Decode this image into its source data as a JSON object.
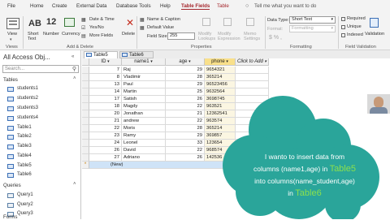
{
  "ribbon_tabs": [
    "File",
    "Home",
    "Create",
    "External Data",
    "Database Tools",
    "Help",
    "Table Fields",
    "Table"
  ],
  "tell_me": "Tell me what you want to do",
  "ribbon": {
    "view": "View",
    "views_group": "Views",
    "short_text": "Short Text",
    "number": "Number",
    "currency": "Currency",
    "date_time": "Date & Time",
    "yes_no": "Yes/No",
    "more_fields": "More Fields",
    "delete": "Delete",
    "add_delete_group": "Add & Delete",
    "name_caption": "Name & Caption",
    "default_value": "Default Value",
    "field_size_label": "Field Size",
    "field_size_value": "255",
    "modify_lookups": "Modify Lookups",
    "modify_expression": "Modify Expression",
    "memo_settings": "Memo Settings",
    "properties_group": "Properties",
    "data_type_label": "Data Type:",
    "data_type_value": "Short Text",
    "format_label": "Format:",
    "format_value": "Formatting",
    "formatting_group": "Formatting",
    "required": "Required",
    "unique": "Unique",
    "indexed": "Indexed",
    "validation": "Validation",
    "field_validation_group": "Field Validation",
    "number_glyph": "12"
  },
  "nav": {
    "title": "All Access Obj...",
    "search_placeholder": "Search...",
    "tables_header": "Tables",
    "tables": [
      "students1",
      "students2",
      "students3",
      "students4",
      "Table1",
      "Table2",
      "Table3",
      "Table4",
      "Table5",
      "Table6"
    ],
    "queries_header": "Queries",
    "queries": [
      "Query1",
      "Query2",
      "Query3"
    ],
    "forms_header": "Forms"
  },
  "doc_tabs": [
    "Table5",
    "Table6"
  ],
  "grid": {
    "columns": [
      "ID",
      "name1",
      "age",
      "phone",
      "Click to Add"
    ],
    "rows": [
      [
        "7",
        "Raj",
        "29",
        "9654321"
      ],
      [
        "8",
        "Vladimir",
        "28",
        "365214"
      ],
      [
        "13",
        "Paul",
        "29",
        "96523456"
      ],
      [
        "14",
        "Martin",
        "25",
        "9632564"
      ],
      [
        "17",
        "Satish",
        "26",
        "3698745"
      ],
      [
        "18",
        "Magdy",
        "22",
        "963521"
      ],
      [
        "20",
        "Jonathan",
        "21",
        "12362541"
      ],
      [
        "21",
        "andrew",
        "22",
        "963574"
      ],
      [
        "22",
        "Moris",
        "28",
        "365214"
      ],
      [
        "23",
        "Ramy",
        "29",
        "369857"
      ],
      [
        "24",
        "Leonel",
        "33",
        "123654"
      ],
      [
        "26",
        "David",
        "22",
        "968574"
      ],
      [
        "27",
        "Adriano",
        "26",
        "142536"
      ]
    ],
    "new_row": "(New)"
  },
  "callout": {
    "line1": "I wanto to insert data from",
    "line2a": "columns (name1,age) in ",
    "line2b": "Table5",
    "line3": "into  columns(name_student,age)",
    "line4a": "in ",
    "line4b": "Table6"
  },
  "colors": {
    "accent": "#a4262c",
    "cloud": "#2aa59a",
    "highlight_text": "#8be04e",
    "selected_header": "#f9e08a"
  }
}
